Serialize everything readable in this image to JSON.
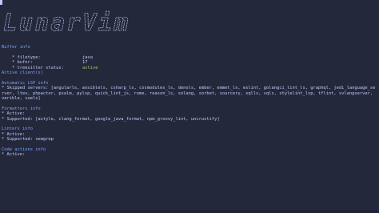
{
  "logo_text": "LunarVim",
  "buffer": {
    "heading": "Buffer info",
    "rows": [
      {
        "key": "* filetype:",
        "value": "java"
      },
      {
        "key": "* bufnr:",
        "value": "17"
      },
      {
        "key": "* treesitter status:",
        "value": "active"
      }
    ]
  },
  "clients_heading": "Active client(s)",
  "lsp": {
    "heading": "Automatic LSP info",
    "skipped": "* Skipped servers: [angularls, ansiblels, csharp_ls, cssmodules_ls, denols, ember, emmet_ls, eslint, golangci_lint_ls, graphql, jedi_language_server, ltex, phpactor, psalm, pylsp, quick_lint_js, rome, reason_ls, solang, sorbet, sourcery, sqlls, sqls, stylelint_lsp, tflint, svlangserver, verible, vuels]"
  },
  "formatters": {
    "heading": "Formatters info",
    "active": "* Active:",
    "supported": "* Supported: [astyle, clang_format, google_java_format, npm_groovy_lint, uncrustify]"
  },
  "linters": {
    "heading": "Linters info",
    "active": "* Active:",
    "supported": "* Supported: semgrep"
  },
  "code_actions": {
    "heading": "Code actions info",
    "active": "* Active:"
  },
  "colors": {
    "background": "#24283b",
    "text": "#c0caf5",
    "heading": "#7aa2f7",
    "active": "#9ece6a"
  }
}
